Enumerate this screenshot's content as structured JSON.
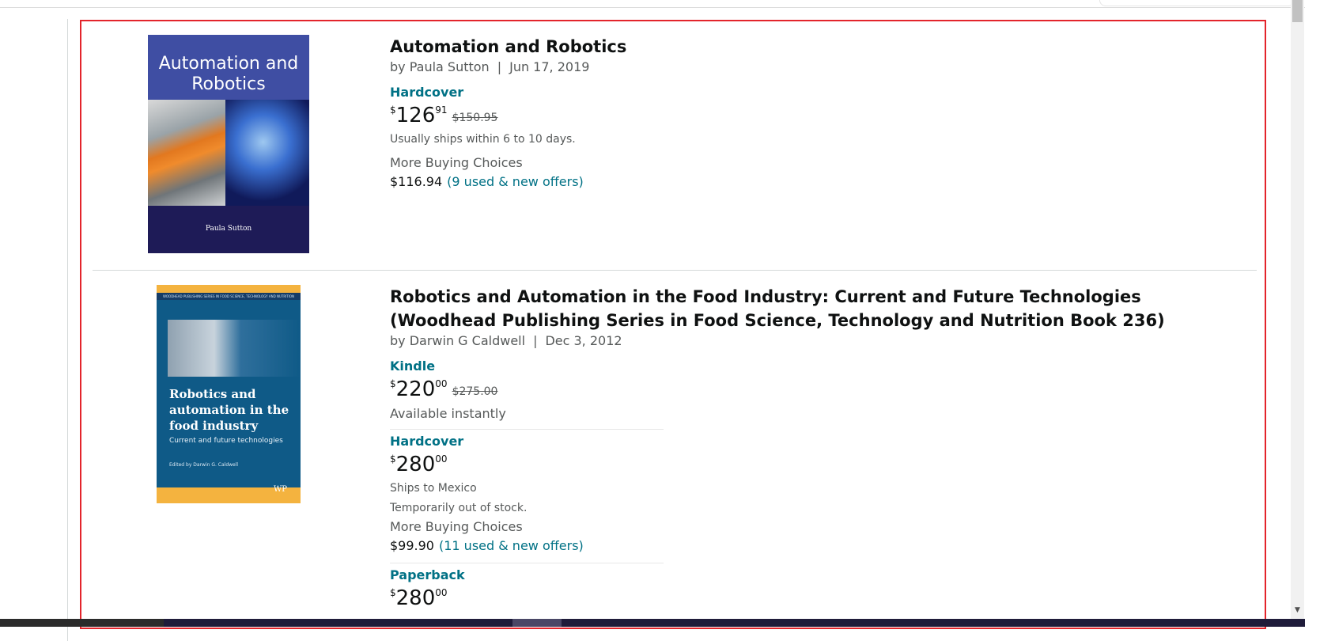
{
  "results": [
    {
      "title": "Automation and Robotics",
      "author": "by Paula Sutton",
      "date": "Jun 17, 2019",
      "separator": "|",
      "cover": {
        "title": "Automation and Robotics",
        "author": "Paula Sutton"
      },
      "formats": [
        {
          "name": "Hardcover",
          "price": {
            "symbol": "$",
            "whole": "126",
            "fraction": "91",
            "list_price": "$150.95"
          },
          "shipping": "Usually ships within 6 to 10 days.",
          "more_choices_label": "More Buying Choices",
          "more_choices_price": "$116.94",
          "more_choices_link": "(9 used & new offers)"
        }
      ]
    },
    {
      "title": "Robotics and Automation in the Food Industry: Current and Future Technologies (Woodhead Publishing Series in Food Science, Technology and Nutrition Book 236)",
      "author": "by Darwin G Caldwell",
      "date": "Dec 3, 2012",
      "separator": "|",
      "cover": {
        "series": "WOODHEAD PUBLISHING SERIES IN FOOD SCIENCE, TECHNOLOGY AND NUTRITION",
        "title": "Robotics and automation in the food industry",
        "subtitle": "Current and future technologies",
        "editor": "Edited by Darwin G. Caldwell",
        "logo": "WP"
      },
      "formats": [
        {
          "name": "Kindle",
          "price": {
            "symbol": "$",
            "whole": "220",
            "fraction": "00",
            "list_price": "$275.00"
          },
          "availability": "Available instantly"
        },
        {
          "name": "Hardcover",
          "price": {
            "symbol": "$",
            "whole": "280",
            "fraction": "00"
          },
          "ships_to": "Ships to Mexico",
          "stock": "Temporarily out of stock.",
          "more_choices_label": "More Buying Choices",
          "more_choices_price": "$99.90",
          "more_choices_link": "(11 used & new offers)"
        },
        {
          "name": "Paperback",
          "price": {
            "symbol": "$",
            "whole": "280",
            "fraction": "00"
          }
        }
      ]
    }
  ],
  "colors": {
    "link": "#007185",
    "highlight_border": "#e3242b",
    "text": "#0f1111",
    "secondary_text": "#565959"
  },
  "scrollbar": {
    "down_arrow_icon": "triangle-down"
  }
}
